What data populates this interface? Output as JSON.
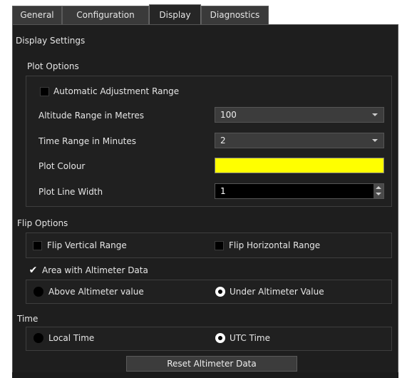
{
  "tabs": [
    {
      "label": "General",
      "active": false
    },
    {
      "label": "Configuration",
      "active": false
    },
    {
      "label": "Display",
      "active": true
    },
    {
      "label": "Diagnostics",
      "active": false
    }
  ],
  "panel_title": "Display Settings",
  "plot_options": {
    "title": "Plot Options",
    "auto_adjust": {
      "label": "Automatic Adjustment Range",
      "checked": false
    },
    "altitude_range": {
      "label": "Altitude Range in Metres",
      "value": "100"
    },
    "time_range": {
      "label": "Time Range in Minutes",
      "value": "2"
    },
    "plot_colour": {
      "label": "Plot Colour",
      "color": "#ffff00"
    },
    "line_width": {
      "label": "Plot Line Width",
      "value": "1"
    }
  },
  "flip_options": {
    "title": "Flip Options",
    "vertical": {
      "label": "Flip Vertical Range",
      "checked": false
    },
    "horizontal": {
      "label": "Flip Horizontal Range",
      "checked": false
    }
  },
  "altimeter": {
    "area_label": "Area with Altimeter Data",
    "area_checked": true,
    "above": {
      "label": "Above Altimeter value",
      "selected": false
    },
    "under": {
      "label": "Under Altimeter Value",
      "selected": true
    }
  },
  "time": {
    "title": "Time",
    "local": {
      "label": "Local Time",
      "selected": false
    },
    "utc": {
      "label": "UTC Time",
      "selected": true
    }
  },
  "reset_button": "Reset Altimeter Data",
  "colors": {
    "panel_bg": "#1e1e1e",
    "accent_plot": "#ffff00"
  }
}
